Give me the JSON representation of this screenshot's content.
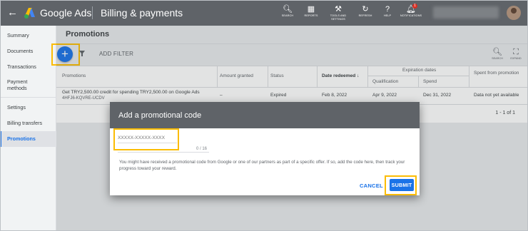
{
  "header": {
    "back_label": "←",
    "app_title": "Google Ads",
    "page_heading": "Billing & payments",
    "tools": [
      {
        "name": "search-icon",
        "glyph": "🔍︎",
        "label": "SEARCH"
      },
      {
        "name": "reports-icon",
        "glyph": "▦",
        "label": "REPORTS"
      },
      {
        "name": "wrench-icon",
        "glyph": "⚒",
        "label": "TOOLS AND SETTINGS"
      },
      {
        "name": "refresh-icon",
        "glyph": "↻",
        "label": "REFRESH"
      },
      {
        "name": "help-icon",
        "glyph": "?",
        "label": "HELP"
      },
      {
        "name": "bell-icon",
        "glyph": "🔔︎",
        "label": "NOTIFICATIONS"
      }
    ],
    "notification_count": "1"
  },
  "sidebar": {
    "items": [
      {
        "label": "Summary"
      },
      {
        "label": "Documents"
      },
      {
        "label": "Transactions"
      },
      {
        "label": "Payment methods"
      },
      {
        "label": "Settings"
      },
      {
        "label": "Billing transfers"
      },
      {
        "label": "Promotions",
        "active": true
      }
    ]
  },
  "main": {
    "title": "Promotions",
    "add_label": "+",
    "add_filter_label": "ADD FILTER",
    "search_tool": {
      "glyph": "🔍︎",
      "label": "SEARCH"
    },
    "expand_tool": {
      "glyph": "⛶",
      "label": "EXPAND"
    }
  },
  "table": {
    "headers": {
      "promotions": "Promotions",
      "amount_granted": "Amount granted",
      "status": "Status",
      "date_redeemed": "Date redeemed",
      "sort_arrow": "↓",
      "expiration_dates": "Expiration dates",
      "qualification": "Qualification",
      "spend": "Spend",
      "spent_from_promotion": "Spent from promotion"
    },
    "rows": [
      {
        "promotion": "Get TRY2,500.00 credit for spending TRY2,500.00 on Google Ads",
        "code": "4HFJ6-KQVRE-UCDV",
        "amount_granted": "–",
        "status": "Expired",
        "date_redeemed": "Feb 8, 2022",
        "qualification": "Apr 9, 2022",
        "spend": "Dec 31, 2022",
        "spent_from_promotion": "Data not yet available"
      }
    ],
    "pagination": "1 - 1 of 1"
  },
  "dialog": {
    "title": "Add a promotional code",
    "input_placeholder": "XXXXX-XXXXX-XXXX",
    "char_count": "0 / 16",
    "help_text": "You might have received a promotional code from Google or one of our partners as part of a specific offer. If so, add the code here, then track your progress toward your reward.",
    "cancel_label": "CANCEL",
    "submit_label": "SUBMIT"
  },
  "colors": {
    "header_bg": "#5f6368",
    "accent": "#1a73e8",
    "highlight": "#fbbc04"
  }
}
